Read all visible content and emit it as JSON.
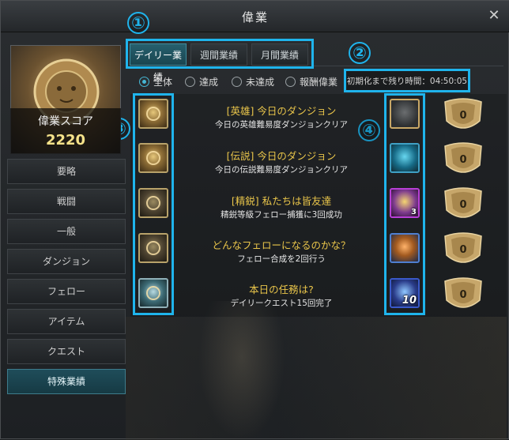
{
  "window": {
    "title": "偉業",
    "close_glyph": "✕"
  },
  "callouts": [
    "①",
    "②",
    "③",
    "④"
  ],
  "score": {
    "label": "偉業スコア",
    "value": "2220"
  },
  "menu": [
    {
      "label": "要略",
      "active": false
    },
    {
      "label": "戦闘",
      "active": false
    },
    {
      "label": "一般",
      "active": false
    },
    {
      "label": "ダンジョン",
      "active": false
    },
    {
      "label": "フェロー",
      "active": false
    },
    {
      "label": "アイテム",
      "active": false
    },
    {
      "label": "クエスト",
      "active": false
    },
    {
      "label": "特殊業績",
      "active": true
    }
  ],
  "tabs": [
    {
      "label": "デイリー業績",
      "active": true
    },
    {
      "label": "週間業績",
      "active": false
    },
    {
      "label": "月間業績",
      "active": false
    }
  ],
  "timer": {
    "text": "初期化まで残り時間：04:50:05"
  },
  "filters": [
    {
      "label": "全体",
      "checked": true
    },
    {
      "label": "達成",
      "checked": false
    },
    {
      "label": "未達成",
      "checked": false
    },
    {
      "label": "報酬偉業",
      "checked": false
    }
  ],
  "achievements": [
    {
      "title": "[英雄] 今日のダンジョン",
      "desc": "今日の英雄難易度ダンジョンクリア",
      "icon": "hero-dungeon-icon",
      "reward_icon": "treasure-chest-icon",
      "reward_count": "",
      "score": "0"
    },
    {
      "title": "[伝説] 今日のダンジョン",
      "desc": "今日の伝説難易度ダンジョンクリア",
      "icon": "legend-dungeon-icon",
      "reward_icon": "teal-chest-icon",
      "reward_count": "",
      "score": "0"
    },
    {
      "title": "[精鋭] 私たちは皆友達",
      "desc": "精鋭等級フェロー捕獲に3回成功",
      "icon": "fellow-capture-icon",
      "reward_icon": "gold-crystal-icon",
      "reward_count": "3",
      "score": "0"
    },
    {
      "title": "どんなフェローになるのかな？",
      "desc": "フェロー合成を2回行う",
      "icon": "fellow-synthesis-icon",
      "reward_icon": "gold-bars-icon",
      "reward_count": "",
      "score": "0"
    },
    {
      "title": "本日の任務は?",
      "desc": "デイリークエスト15回完了",
      "icon": "daily-quest-icon",
      "reward_icon": "blue-chest-icon",
      "reward_count": "10",
      "score": "0"
    }
  ],
  "colors": {
    "accent": "#1fb4ec",
    "gold_text": "#e9c54a",
    "score_text": "#f5e28a",
    "active_tab": "#1a4550"
  }
}
